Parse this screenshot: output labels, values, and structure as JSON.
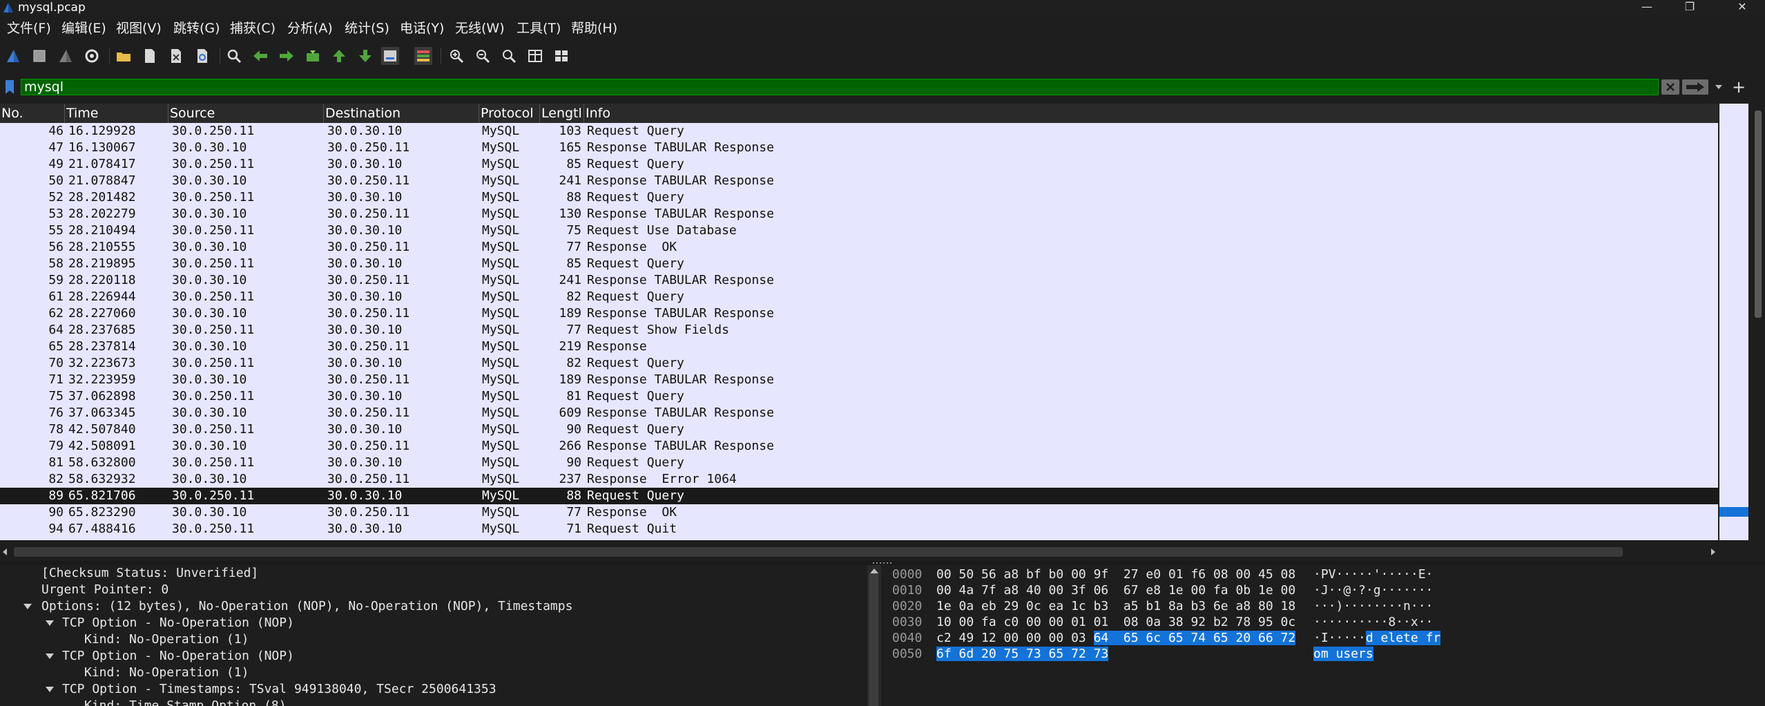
{
  "window": {
    "title": "mysql.pcap",
    "minimize": "—",
    "maximize": "❐",
    "close": "✕"
  },
  "menu": [
    "文件(F)",
    "编辑(E)",
    "视图(V)",
    "跳转(G)",
    "捕获(C)",
    "分析(A)",
    "统计(S)",
    "电话(Y)",
    "无线(W)",
    "工具(T)",
    "帮助(H)"
  ],
  "toolbar_icons": [
    "shark-fin-icon",
    "stop-icon",
    "restart-icon",
    "options-gear-icon",
    "open-folder-icon",
    "file-icon",
    "close-file-icon",
    "reload-icon",
    "find-icon",
    "go-back-icon",
    "go-forward-icon",
    "go-to-packet-icon",
    "first-packet-icon",
    "last-packet-icon",
    "autoscroll-icon",
    "colorize-icon",
    "zoom-in-icon",
    "zoom-out-icon",
    "normal-size-icon",
    "resize-columns-icon",
    "layout-icon"
  ],
  "filter": {
    "value": "mysql",
    "accent": "#006400"
  },
  "columns": [
    "No.",
    "Time",
    "Source",
    "Destination",
    "Protocol",
    "Lengtl",
    "Info"
  ],
  "packets": [
    {
      "no": "46",
      "time": "16.129928",
      "src": "30.0.250.11",
      "dst": "30.0.30.10",
      "proto": "MySQL",
      "len": "103",
      "info": "Request Query"
    },
    {
      "no": "47",
      "time": "16.130067",
      "src": "30.0.30.10",
      "dst": "30.0.250.11",
      "proto": "MySQL",
      "len": "165",
      "info": "Response TABULAR Response"
    },
    {
      "no": "49",
      "time": "21.078417",
      "src": "30.0.250.11",
      "dst": "30.0.30.10",
      "proto": "MySQL",
      "len": "85",
      "info": "Request Query"
    },
    {
      "no": "50",
      "time": "21.078847",
      "src": "30.0.30.10",
      "dst": "30.0.250.11",
      "proto": "MySQL",
      "len": "241",
      "info": "Response TABULAR Response"
    },
    {
      "no": "52",
      "time": "28.201482",
      "src": "30.0.250.11",
      "dst": "30.0.30.10",
      "proto": "MySQL",
      "len": "88",
      "info": "Request Query"
    },
    {
      "no": "53",
      "time": "28.202279",
      "src": "30.0.30.10",
      "dst": "30.0.250.11",
      "proto": "MySQL",
      "len": "130",
      "info": "Response TABULAR Response"
    },
    {
      "no": "55",
      "time": "28.210494",
      "src": "30.0.250.11",
      "dst": "30.0.30.10",
      "proto": "MySQL",
      "len": "75",
      "info": "Request Use Database"
    },
    {
      "no": "56",
      "time": "28.210555",
      "src": "30.0.30.10",
      "dst": "30.0.250.11",
      "proto": "MySQL",
      "len": "77",
      "info": "Response  OK"
    },
    {
      "no": "58",
      "time": "28.219895",
      "src": "30.0.250.11",
      "dst": "30.0.30.10",
      "proto": "MySQL",
      "len": "85",
      "info": "Request Query"
    },
    {
      "no": "59",
      "time": "28.220118",
      "src": "30.0.30.10",
      "dst": "30.0.250.11",
      "proto": "MySQL",
      "len": "241",
      "info": "Response TABULAR Response"
    },
    {
      "no": "61",
      "time": "28.226944",
      "src": "30.0.250.11",
      "dst": "30.0.30.10",
      "proto": "MySQL",
      "len": "82",
      "info": "Request Query"
    },
    {
      "no": "62",
      "time": "28.227060",
      "src": "30.0.30.10",
      "dst": "30.0.250.11",
      "proto": "MySQL",
      "len": "189",
      "info": "Response TABULAR Response"
    },
    {
      "no": "64",
      "time": "28.237685",
      "src": "30.0.250.11",
      "dst": "30.0.30.10",
      "proto": "MySQL",
      "len": "77",
      "info": "Request Show Fields"
    },
    {
      "no": "65",
      "time": "28.237814",
      "src": "30.0.30.10",
      "dst": "30.0.250.11",
      "proto": "MySQL",
      "len": "219",
      "info": "Response"
    },
    {
      "no": "70",
      "time": "32.223673",
      "src": "30.0.250.11",
      "dst": "30.0.30.10",
      "proto": "MySQL",
      "len": "82",
      "info": "Request Query"
    },
    {
      "no": "71",
      "time": "32.223959",
      "src": "30.0.30.10",
      "dst": "30.0.250.11",
      "proto": "MySQL",
      "len": "189",
      "info": "Response TABULAR Response"
    },
    {
      "no": "75",
      "time": "37.062898",
      "src": "30.0.250.11",
      "dst": "30.0.30.10",
      "proto": "MySQL",
      "len": "81",
      "info": "Request Query"
    },
    {
      "no": "76",
      "time": "37.063345",
      "src": "30.0.30.10",
      "dst": "30.0.250.11",
      "proto": "MySQL",
      "len": "609",
      "info": "Response TABULAR Response"
    },
    {
      "no": "78",
      "time": "42.507840",
      "src": "30.0.250.11",
      "dst": "30.0.30.10",
      "proto": "MySQL",
      "len": "90",
      "info": "Request Query"
    },
    {
      "no": "79",
      "time": "42.508091",
      "src": "30.0.30.10",
      "dst": "30.0.250.11",
      "proto": "MySQL",
      "len": "266",
      "info": "Response TABULAR Response"
    },
    {
      "no": "81",
      "time": "58.632800",
      "src": "30.0.250.11",
      "dst": "30.0.30.10",
      "proto": "MySQL",
      "len": "90",
      "info": "Request Query"
    },
    {
      "no": "82",
      "time": "58.632932",
      "src": "30.0.30.10",
      "dst": "30.0.250.11",
      "proto": "MySQL",
      "len": "237",
      "info": "Response  Error 1064"
    },
    {
      "no": "89",
      "time": "65.821706",
      "src": "30.0.250.11",
      "dst": "30.0.30.10",
      "proto": "MySQL",
      "len": "88",
      "info": "Request Query",
      "selected": true
    },
    {
      "no": "90",
      "time": "65.823290",
      "src": "30.0.30.10",
      "dst": "30.0.250.11",
      "proto": "MySQL",
      "len": "77",
      "info": "Response  OK"
    },
    {
      "no": "94",
      "time": "67.488416",
      "src": "30.0.250.11",
      "dst": "30.0.30.10",
      "proto": "MySQL",
      "len": "71",
      "info": "Request Quit"
    }
  ],
  "details": [
    {
      "text": "[Checksum Status: Unverified]",
      "level": 1,
      "expander": false
    },
    {
      "text": "Urgent Pointer: 0",
      "level": 1,
      "expander": false
    },
    {
      "text": "Options: (12 bytes), No-Operation (NOP), No-Operation (NOP), Timestamps",
      "level": 1,
      "expander": true
    },
    {
      "text": "TCP Option - No-Operation (NOP)",
      "level": 2,
      "expander": true
    },
    {
      "text": "Kind: No-Operation (1)",
      "level": 3,
      "expander": false
    },
    {
      "text": "TCP Option - No-Operation (NOP)",
      "level": 2,
      "expander": true
    },
    {
      "text": "Kind: No-Operation (1)",
      "level": 3,
      "expander": false
    },
    {
      "text": "TCP Option - Timestamps: TSval 949138040, TSecr 2500641353",
      "level": 2,
      "expander": true
    },
    {
      "text": "Kind: Time Stamp Option (8)",
      "level": 3,
      "expander": false
    }
  ],
  "bytes": [
    {
      "offset": "0000",
      "hex": "00 50 56 a8 bf b0 00 9f  27 e0 01 f6 08 00 45 08",
      "hex_hl": "",
      "ascii": "·PV·····'·····E·",
      "ascii_hl": ""
    },
    {
      "offset": "0010",
      "hex": "00 4a 7f a8 40 00 3f 06  67 e8 1e 00 fa 0b 1e 00",
      "hex_hl": "",
      "ascii": "·J··@·?·g·······",
      "ascii_hl": ""
    },
    {
      "offset": "0020",
      "hex": "1e 0a eb 29 0c ea 1c b3  a5 b1 8a b3 6e a8 80 18",
      "hex_hl": "",
      "ascii": "···)········n···",
      "ascii_hl": ""
    },
    {
      "offset": "0030",
      "hex": "10 00 fa c0 00 00 01 01  08 0a 38 92 b2 78 95 0c",
      "hex_hl": "",
      "ascii": "··········8··x··",
      "ascii_hl": ""
    },
    {
      "offset": "0040",
      "hex": "c2 49 12 00 00 00 03 ",
      "hex_hl": "64  65 6c 65 74 65 20 66 72",
      "ascii": "·I·····",
      "ascii_hl": "d elete fr"
    },
    {
      "offset": "0050",
      "hex": "",
      "hex_hl": "6f 6d 20 75 73 65 72 73",
      "ascii": "",
      "ascii_hl": "om users"
    }
  ]
}
